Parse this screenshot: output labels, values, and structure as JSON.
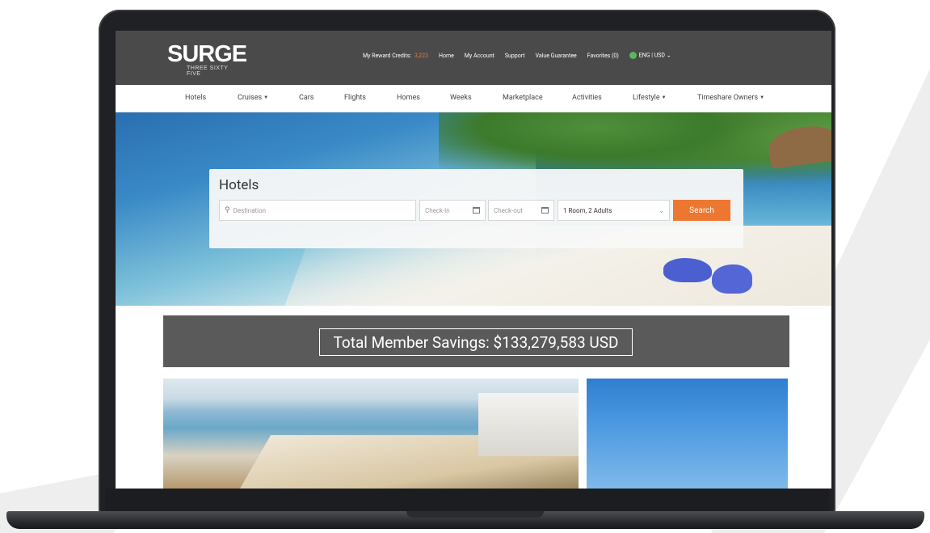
{
  "colors": {
    "header_bg": "#4a4a4a",
    "accent": "#ed7630",
    "banner_bg": "#5a5a5a"
  },
  "header": {
    "logo_text": "SURGE",
    "logo_subtext": "THREE SIXTY FIVE",
    "reward_credits_label": "My Reward Credits:",
    "reward_credits_value": "3,223",
    "links": [
      "Home",
      "My Account",
      "Support",
      "Value Guarantee",
      "Favorites (0)"
    ],
    "locale_label": "ENG | USD",
    "locale_icon": "globe-icon"
  },
  "nav": {
    "items": [
      {
        "label": "Hotels",
        "dropdown": false
      },
      {
        "label": "Cruises",
        "dropdown": true
      },
      {
        "label": "Cars",
        "dropdown": false
      },
      {
        "label": "Flights",
        "dropdown": false
      },
      {
        "label": "Homes",
        "dropdown": false
      },
      {
        "label": "Weeks",
        "dropdown": false
      },
      {
        "label": "Marketplace",
        "dropdown": false
      },
      {
        "label": "Activities",
        "dropdown": false
      },
      {
        "label": "Lifestyle",
        "dropdown": true
      },
      {
        "label": "Timeshare Owners",
        "dropdown": true
      }
    ]
  },
  "search": {
    "title": "Hotels",
    "destination_placeholder": "Destination",
    "checkin_placeholder": "Check-in",
    "checkout_placeholder": "Check-out",
    "rooms_value": "1 Room, 2 Adults",
    "button_label": "Search"
  },
  "savings": {
    "text": "Total Member Savings: $133,279,583 USD"
  }
}
